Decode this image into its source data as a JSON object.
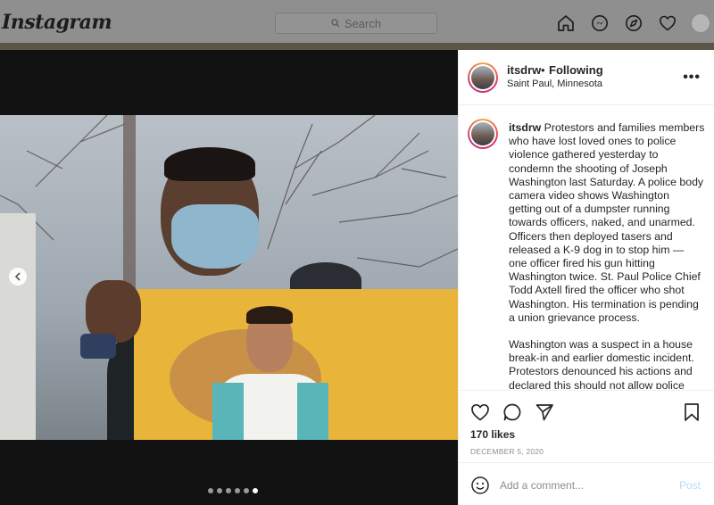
{
  "nav": {
    "logo": "Instagram",
    "search_placeholder": "Search",
    "icons": [
      "home-icon",
      "messenger-icon",
      "explore-icon",
      "heart-icon",
      "profile-avatar"
    ]
  },
  "carousel": {
    "slide_count": 6,
    "active_index": 5
  },
  "post": {
    "username": "itsdrw",
    "separator": "•",
    "follow_status": "Following",
    "location": "Saint Paul, Minnesota",
    "more_label": "•••",
    "caption_user": "itsdrw",
    "caption_p1": "Protestors and families members who have lost loved ones to police violence gathered yesterday to condemn the shooting of Joseph Washington last Saturday. A police body camera video shows Washington getting out of a dumpster running towards officers, naked, and unarmed. Officers then deployed tasers and released a K-9 dog in to stop him — one officer fired his gun hitting Washington twice. St. Paul Police Chief Todd Axtell fired the officer who shot Washington. His termination is pending a union grievance process.",
    "caption_p2": "Washington was a suspect in a house break-in and earlier domestic incident. Protestors denounced his actions and declared this should not allow police",
    "likes": "170 likes",
    "date": "DECEMBER 5, 2020",
    "comment_placeholder": "Add a comment...",
    "post_button": "Post"
  },
  "colors": {
    "post_button": "#b3dbff",
    "story_ring": [
      "#f9a23a",
      "#e1306c",
      "#c13584"
    ]
  }
}
